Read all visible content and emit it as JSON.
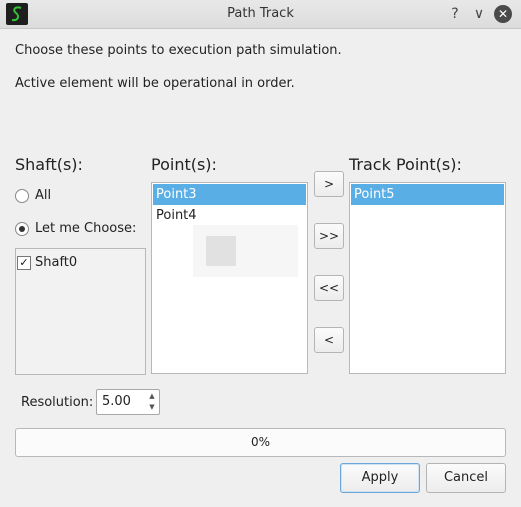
{
  "window": {
    "title": "Path Track",
    "help_glyph": "?",
    "minimize_glyph": "∨",
    "close_glyph": "✕"
  },
  "intro": {
    "line1": "Choose these points to execution path simulation.",
    "line2": "Active element will be operational in order."
  },
  "shafts": {
    "header": "Shaft(s):",
    "all_label": "All",
    "choose_label": "Let me Choose:",
    "selected_option": "Let me Choose:",
    "items": [
      {
        "label": "Shaft0",
        "checked": true,
        "check_glyph": "✓"
      }
    ]
  },
  "points": {
    "header": "Point(s):",
    "items": [
      {
        "label": "Point3",
        "selected": true
      },
      {
        "label": "Point4",
        "selected": false
      }
    ]
  },
  "transfer": {
    "add": ">",
    "add_all": ">>",
    "remove_all": "<<",
    "remove": "<"
  },
  "track_points": {
    "header": "Track Point(s):",
    "items": [
      {
        "label": "Point5",
        "selected": true
      }
    ]
  },
  "resolution": {
    "label": "Resolution:",
    "value": "5.00"
  },
  "progress": {
    "value": 0,
    "text": "0%"
  },
  "buttons": {
    "apply": "Apply",
    "cancel": "Cancel"
  },
  "colors": {
    "selection": "#5aaee6",
    "dialog_bg": "#efefef"
  }
}
